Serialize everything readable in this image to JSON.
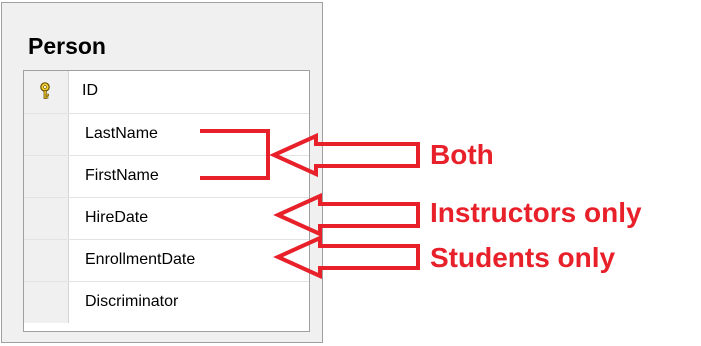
{
  "table": {
    "title": "Person",
    "columns": [
      {
        "name": "ID",
        "is_key": true
      },
      {
        "name": "LastName",
        "is_key": false
      },
      {
        "name": "FirstName",
        "is_key": false
      },
      {
        "name": "HireDate",
        "is_key": false
      },
      {
        "name": "EnrollmentDate",
        "is_key": false
      },
      {
        "name": "Discriminator",
        "is_key": false
      }
    ]
  },
  "annotations": {
    "color": "#e8202a",
    "both_label": "Both",
    "instructors_label": "Instructors only",
    "students_label": "Students only"
  },
  "icons": {
    "key": "key-icon"
  }
}
